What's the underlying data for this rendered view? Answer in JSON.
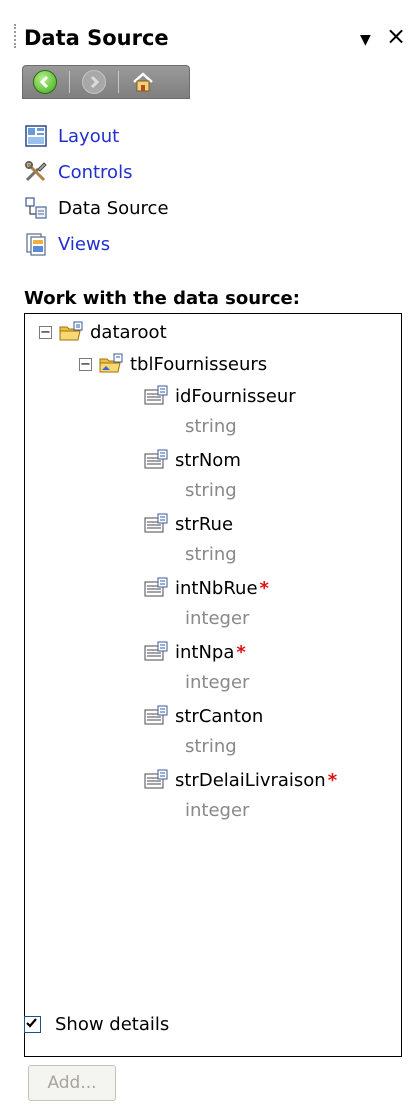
{
  "header": {
    "title": "Data Source",
    "pin_glyph": "▼",
    "close_glyph": "×"
  },
  "nav": {
    "back_icon": "back-arrow-icon",
    "forward_icon": "forward-arrow-icon",
    "home_icon": "home-icon"
  },
  "links": [
    {
      "label": "Layout",
      "icon": "layout-icon",
      "current": false
    },
    {
      "label": "Controls",
      "icon": "controls-icon",
      "current": false
    },
    {
      "label": "Data Source",
      "icon": "data-source-icon",
      "current": true
    },
    {
      "label": "Views",
      "icon": "views-icon",
      "current": false
    }
  ],
  "section_title": "Work with the data source:",
  "tree": {
    "root": {
      "label": "dataroot",
      "expander": "−"
    },
    "group": {
      "label": "tblFournisseurs",
      "expander": "−"
    },
    "fields": [
      {
        "name": "idFournisseur",
        "type": "string",
        "required": false
      },
      {
        "name": "strNom",
        "type": "string",
        "required": false
      },
      {
        "name": "strRue",
        "type": "string",
        "required": false
      },
      {
        "name": "intNbRue",
        "type": "integer",
        "required": true
      },
      {
        "name": "intNpa",
        "type": "integer",
        "required": true
      },
      {
        "name": "strCanton",
        "type": "string",
        "required": false
      },
      {
        "name": "strDelaiLivraison",
        "type": "integer",
        "required": true
      }
    ],
    "required_mark": "*"
  },
  "show_details": {
    "label": "Show details",
    "checked": true
  },
  "add_button": {
    "label": "Add...",
    "enabled": false
  },
  "colors": {
    "link": "#1f2fd0",
    "type_text": "#888888",
    "required": "#e01010",
    "folder": "#f0c040"
  }
}
